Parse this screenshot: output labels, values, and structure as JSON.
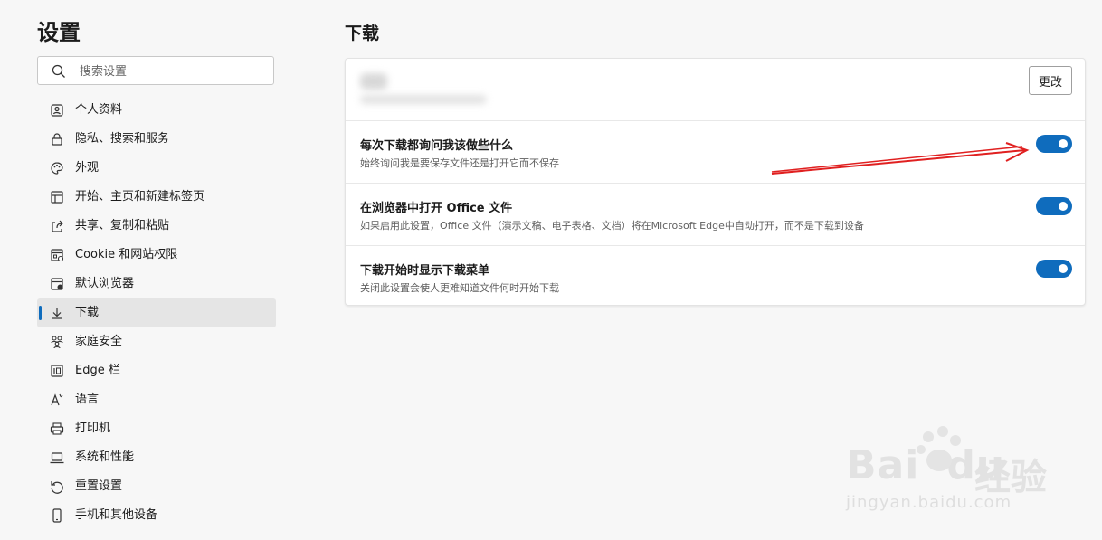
{
  "sidebar": {
    "title": "设置",
    "search_placeholder": "搜索设置",
    "items": [
      {
        "label": "个人资料",
        "icon": "profile-icon"
      },
      {
        "label": "隐私、搜索和服务",
        "icon": "lock-icon"
      },
      {
        "label": "外观",
        "icon": "palette-icon"
      },
      {
        "label": "开始、主页和新建标签页",
        "icon": "home-icon"
      },
      {
        "label": "共享、复制和粘贴",
        "icon": "share-icon"
      },
      {
        "label": "Cookie 和网站权限",
        "icon": "site-permissions-icon"
      },
      {
        "label": "默认浏览器",
        "icon": "default-browser-icon"
      },
      {
        "label": "下载",
        "icon": "download-icon",
        "active": true
      },
      {
        "label": "家庭安全",
        "icon": "family-icon"
      },
      {
        "label": "Edge 栏",
        "icon": "edge-bar-icon"
      },
      {
        "label": "语言",
        "icon": "language-icon"
      },
      {
        "label": "打印机",
        "icon": "printer-icon"
      },
      {
        "label": "系统和性能",
        "icon": "laptop-icon"
      },
      {
        "label": "重置设置",
        "icon": "reset-icon"
      },
      {
        "label": "手机和其他设备",
        "icon": "phone-icon"
      }
    ]
  },
  "main": {
    "title": "下载",
    "location": {
      "change_label": "更改"
    },
    "settings": [
      {
        "title": "每次下载都询问我该做些什么",
        "desc": "始终询问我是要保存文件还是打开它而不保存",
        "enabled": true
      },
      {
        "title": "在浏览器中打开 Office 文件",
        "desc": "如果启用此设置，Office 文件（演示文稿、电子表格、文档）将在Microsoft Edge中自动打开，而不是下载到设备",
        "enabled": true
      },
      {
        "title": "下载开始时显示下载菜单",
        "desc": "关闭此设置会使人更难知道文件何时开始下载",
        "enabled": true
      }
    ]
  },
  "watermark": {
    "brand": "Bai",
    "brand_suffix": "du",
    "brand_cn": "经验",
    "url": "jingyan.baidu.com"
  },
  "colors": {
    "accent": "#0f6cbd",
    "annotation_arrow": "#e02020"
  }
}
